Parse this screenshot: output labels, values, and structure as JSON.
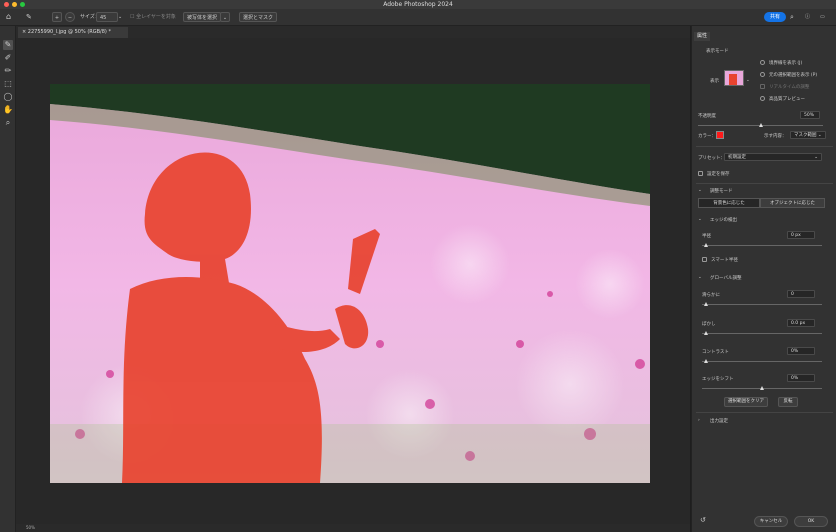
{
  "app_title": "Adobe Photoshop 2024",
  "options_bar": {
    "size_label": "サイズ：",
    "size_value": "45",
    "sample_all_layers": "全レイヤーを対象",
    "select_subject": "被写体を選択",
    "select_and_mask": "選択とマスク",
    "share": "共有"
  },
  "document_tab": "22755990_l.jpg @ 50% (RGB/8) *",
  "status": "50%",
  "panel": {
    "tab": "属性",
    "view_mode_label": "表示モード",
    "view_label": "表示",
    "show_edge": "境界線を表示 (J)",
    "show_original": "元の選択範囲を表示 (P)",
    "realtime_refine": "リアルタイムの調整",
    "high_quality_preview": "高品質プレビュー",
    "opacity_label": "不透明度",
    "opacity_value": "50%",
    "opacity_level": 0.5,
    "color_label": "カラー：",
    "overlay_color": "#ff1a1a",
    "indicates_label": "示す内容：",
    "indicates_value": "マスク範囲",
    "preset_label": "プリセット：",
    "preset_value": "初期設定",
    "remember_settings": "設定を保存",
    "refine_mode_title": "調整モード",
    "mode_color_aware": "背景色に応じた",
    "mode_object_aware": "オブジェクトに応じた",
    "edge_detection_title": "エッジの検出",
    "radius_label": "半径",
    "radius_value": "0 px",
    "smart_radius": "スマート半径",
    "global_refinements_title": "グローバル調整",
    "smooth_label": "滑らかに",
    "smooth_value": "0",
    "feather_label": "ぼかし",
    "feather_value": "0.0 px",
    "contrast_label": "コントラスト",
    "contrast_value": "0%",
    "shift_edge_label": "エッジをシフト",
    "shift_edge_value": "0%",
    "clear_selection": "選択範囲をクリア",
    "invert": "反転",
    "output_settings_title": "出力設定",
    "cancel": "キャンセル",
    "ok": "OK"
  },
  "colors": {
    "accent": "#1473e6",
    "overlay": "#ff3a2a"
  }
}
